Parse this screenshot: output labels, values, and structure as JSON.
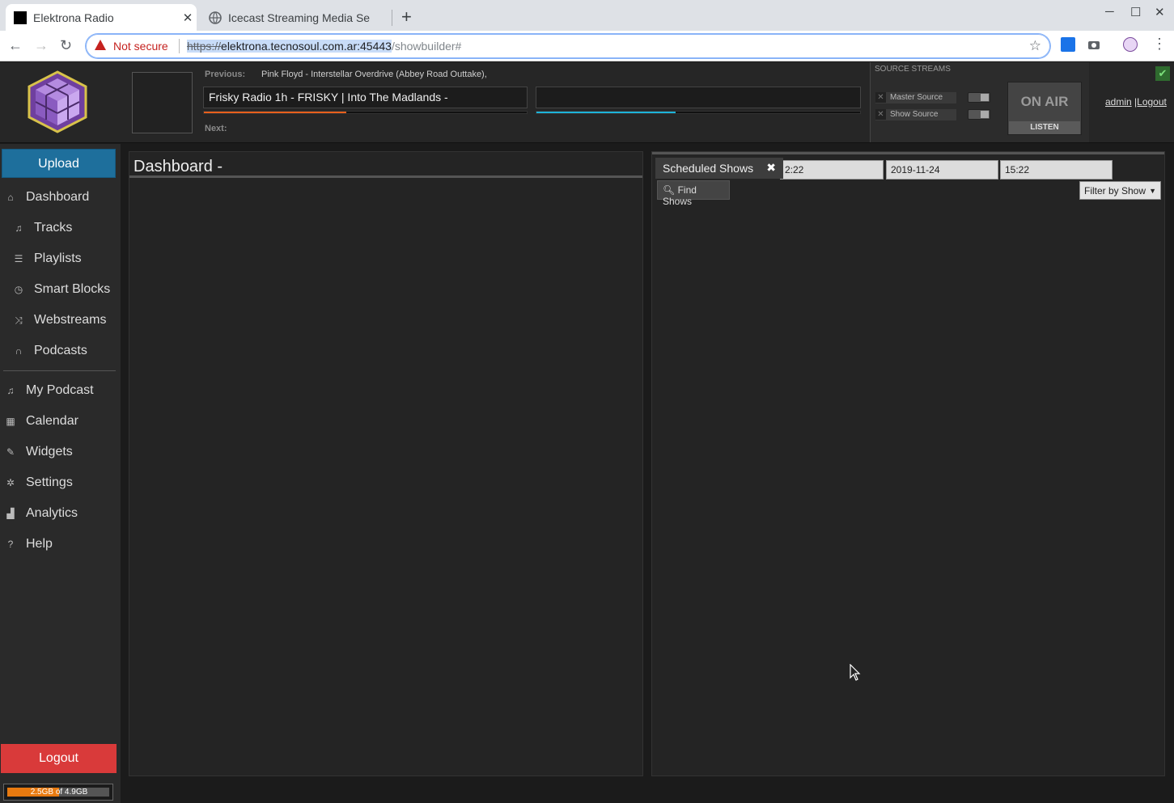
{
  "browser": {
    "tabs": [
      {
        "title": "Elektrona Radio",
        "active": true
      },
      {
        "title": "Icecast Streaming Media Se",
        "active": false
      }
    ],
    "security_label": "Not secure",
    "url_protocol": "https://",
    "url_host": "elektrona.tecnosoul.com.ar:45443",
    "url_path": "/showbuilder#"
  },
  "header": {
    "previous_label": "Previous:",
    "previous_value": "Pink Floyd - Interstellar Overdrive (Abbey Road Outtake),",
    "current_track": "Frisky Radio 1h - FRISKY | Into The Madlands -",
    "next_label": "Next:",
    "current_progress": 0.44,
    "next_progress": 0.43,
    "source_streams_title": "SOURCE STREAMS",
    "master_source": "Master Source",
    "show_source": "Show Source",
    "on_air": "ON AIR",
    "listen": "LISTEN",
    "user": "admin",
    "logout_link": "|Logout"
  },
  "sidebar": {
    "upload": "Upload",
    "items": [
      {
        "label": "Dashboard",
        "icon": "home-icon"
      },
      {
        "label": "Tracks",
        "icon": "music-note-icon"
      },
      {
        "label": "Playlists",
        "icon": "list-icon"
      },
      {
        "label": "Smart Blocks",
        "icon": "clock-icon"
      },
      {
        "label": "Webstreams",
        "icon": "shuffle-icon"
      },
      {
        "label": "Podcasts",
        "icon": "headphones-icon"
      },
      {
        "label": "My Podcast",
        "icon": "music-note-icon"
      },
      {
        "label": "Calendar",
        "icon": "calendar-icon"
      },
      {
        "label": "Widgets",
        "icon": "wrench-icon"
      },
      {
        "label": "Settings",
        "icon": "gear-icon"
      },
      {
        "label": "Analytics",
        "icon": "bar-chart-icon"
      },
      {
        "label": "Help",
        "icon": "help-icon"
      }
    ],
    "logout": "Logout",
    "disk_usage": "2.5GB of 4.9GB",
    "disk_fraction": 0.51
  },
  "dashboard": {
    "title": "Dashboard -"
  },
  "schedule": {
    "tab_label": "Scheduled Shows",
    "start_time": "2:22",
    "end_date": "2019-11-24",
    "end_time": "15:22",
    "find_shows": "Find Shows",
    "filter": "Filter by Show"
  }
}
